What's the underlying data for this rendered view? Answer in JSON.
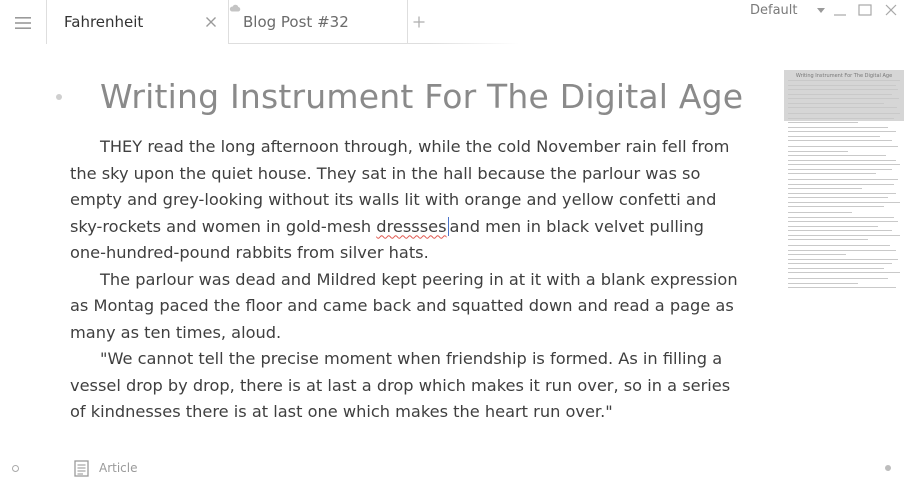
{
  "tabs": [
    {
      "label": "Fahrenheit",
      "active": true
    },
    {
      "label": "Blog Post #32",
      "active": false
    }
  ],
  "profile": {
    "label": "Default"
  },
  "icons": {
    "menu": "hamburger-icon",
    "close": "close-icon",
    "cloud": "cloud-icon",
    "add": "plus-icon",
    "minimize": "minimize-icon",
    "maximize": "maximize-icon",
    "window_close": "close-icon",
    "doc_type": "document-icon"
  },
  "document": {
    "title": "Writing Instrument For The Digital Age",
    "paragraphs": [
      {
        "before": "THEY read the long afternoon through, while the cold November rain fell from the sky upon the quiet house. They sat in the hall because the parlour was so empty and grey-looking without its walls lit with orange and yellow confetti and sky-rockets and women in gold-mesh ",
        "misspelled": "dressses",
        "after": "and men in black velvet pulling one-hundred-pound rabbits from silver hats."
      },
      {
        "text": "The parlour was dead and Mildred kept peering in at it with a blank expression as Montag paced the floor and came back and squatted down and read a page as many as ten times, aloud."
      },
      {
        "text": "\"We cannot tell the precise moment when friendship is formed. As in filling a vessel drop by drop, there is at last a drop which makes it run over, so in a series of kindnesses there is at last one which makes the heart run over.\""
      }
    ]
  },
  "minimap": {
    "title": "Writing Instrument For The Digital Age"
  },
  "status": {
    "doc_type": "Article"
  },
  "colors": {
    "accent_caret": "#4a73c9",
    "spell_error": "#e0584f",
    "title": "#8a8a8a"
  }
}
